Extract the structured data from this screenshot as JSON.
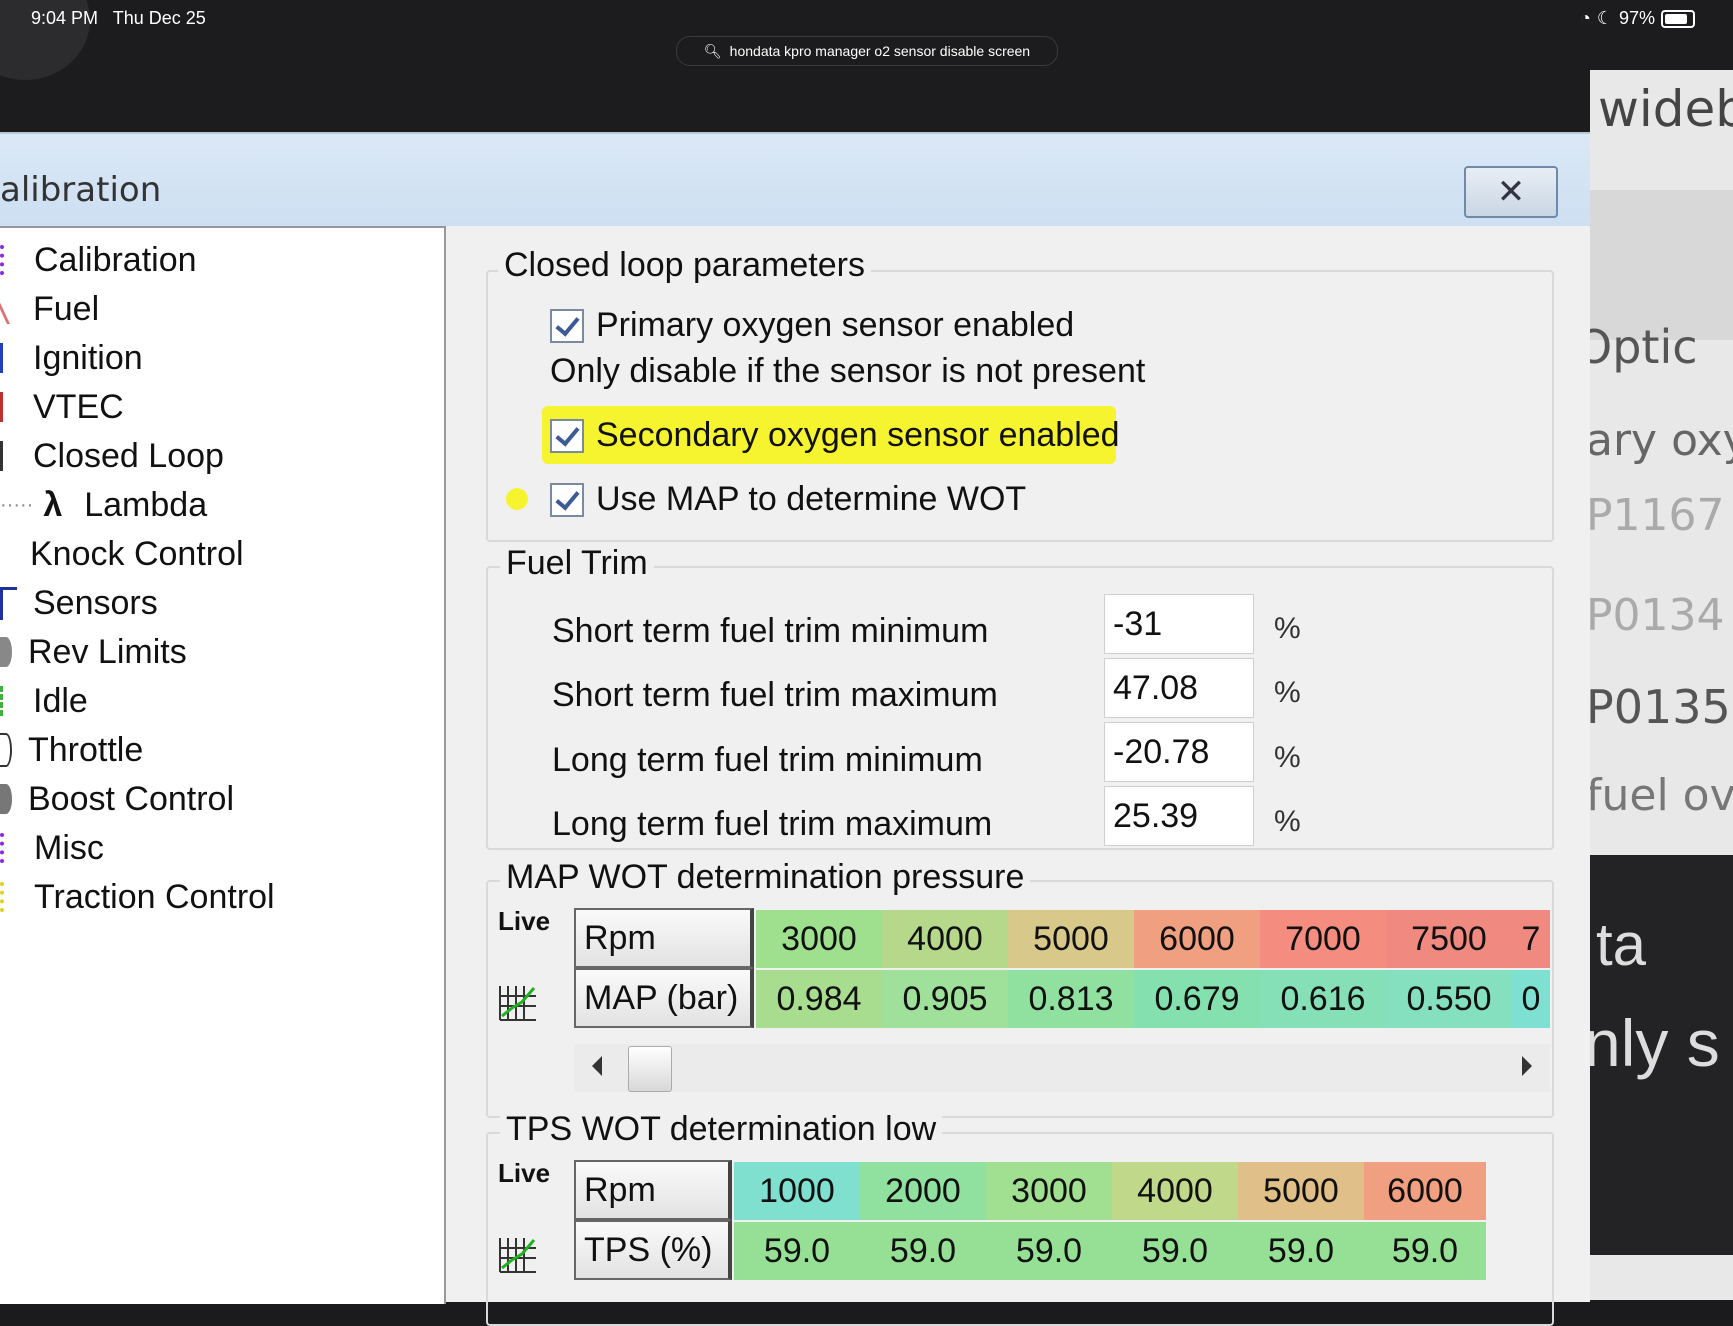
{
  "status_bar": {
    "time": "9:04 PM",
    "date": "Thu Dec 25",
    "battery": "97%"
  },
  "browser": {
    "url": "hondata kpro manager o2 sensor disable screen"
  },
  "background_right": {
    "texts": [
      "wideb",
      "Optic",
      "ary oxy",
      "P1167",
      "P0134",
      "P0135",
      "fuel ov",
      "ta",
      "nly s"
    ]
  },
  "dialog": {
    "title": "alibration",
    "tree": [
      {
        "label": "Calibration",
        "color": "#8a2be2"
      },
      {
        "label": "Fuel",
        "color": "#e05050"
      },
      {
        "label": "Ignition",
        "color": "#2040c0"
      },
      {
        "label": "VTEC",
        "color": "#c03030"
      },
      {
        "label": "Closed Loop",
        "color": "#333333"
      },
      {
        "label": "Lambda",
        "color": "#000000",
        "glyph": "λ"
      },
      {
        "label": "Knock Control",
        "color": "#ffffff"
      },
      {
        "label": "Sensors",
        "color": "#2030a0"
      },
      {
        "label": "Rev Limits",
        "color": "#b03030"
      },
      {
        "label": "Idle",
        "color": "#40b040"
      },
      {
        "label": "Throttle",
        "color": "#333333"
      },
      {
        "label": "Boost Control",
        "color": "#555555"
      },
      {
        "label": "Misc",
        "color": "#8a2be2"
      },
      {
        "label": "Traction Control",
        "color": "#e0d020"
      }
    ],
    "closed_loop": {
      "title": "Closed loop parameters",
      "primary_label": "Primary oxygen sensor enabled",
      "primary_note": "Only disable if the sensor is not present",
      "secondary_label": "Secondary oxygen sensor enabled",
      "map_wot_label": "Use MAP to determine WOT"
    },
    "fuel_trim": {
      "title": "Fuel Trim",
      "rows": [
        {
          "label": "Short term fuel trim minimum",
          "value": "-31",
          "unit": "%"
        },
        {
          "label": "Short term fuel trim maximum",
          "value": "47.08",
          "unit": "%"
        },
        {
          "label": "Long term fuel trim minimum",
          "value": "-20.78",
          "unit": "%"
        },
        {
          "label": "Long term fuel trim maximum",
          "value": "25.39",
          "unit": "%"
        }
      ]
    },
    "map_wot": {
      "title": "MAP WOT determination pressure",
      "live": "Live",
      "row1_head": "Rpm",
      "row2_head": "MAP (bar)",
      "rpm": [
        "3000",
        "4000",
        "5000",
        "6000",
        "7000",
        "7500",
        "7"
      ],
      "values": [
        "0.984",
        "0.905",
        "0.813",
        "0.679",
        "0.616",
        "0.550",
        "0"
      ],
      "rpm_colors": [
        "#9fe08f",
        "#b6d88a",
        "#d8c98a",
        "#f0a080",
        "#f58c80",
        "#f08a80",
        "#f08a80"
      ],
      "val_colors": [
        "#a8dd90",
        "#9fe09a",
        "#90e0a0",
        "#85e0b0",
        "#85e0b8",
        "#85e0c0",
        "#7ee0d0"
      ]
    },
    "tps_wot": {
      "title": "TPS WOT determination low",
      "live": "Live",
      "row1_head": "Rpm",
      "row2_head": "TPS (%)",
      "rpm": [
        "1000",
        "2000",
        "3000",
        "4000",
        "5000",
        "6000"
      ],
      "values": [
        "59.0",
        "59.0",
        "59.0",
        "59.0",
        "59.0",
        "59.0"
      ],
      "rpm_colors": [
        "#80e0d0",
        "#90e0a0",
        "#a0e090",
        "#c0d88a",
        "#e0c088",
        "#f0a080"
      ],
      "val_colors": [
        "#95e095",
        "#95e095",
        "#95e095",
        "#95e095",
        "#95e095",
        "#95e095"
      ]
    }
  }
}
